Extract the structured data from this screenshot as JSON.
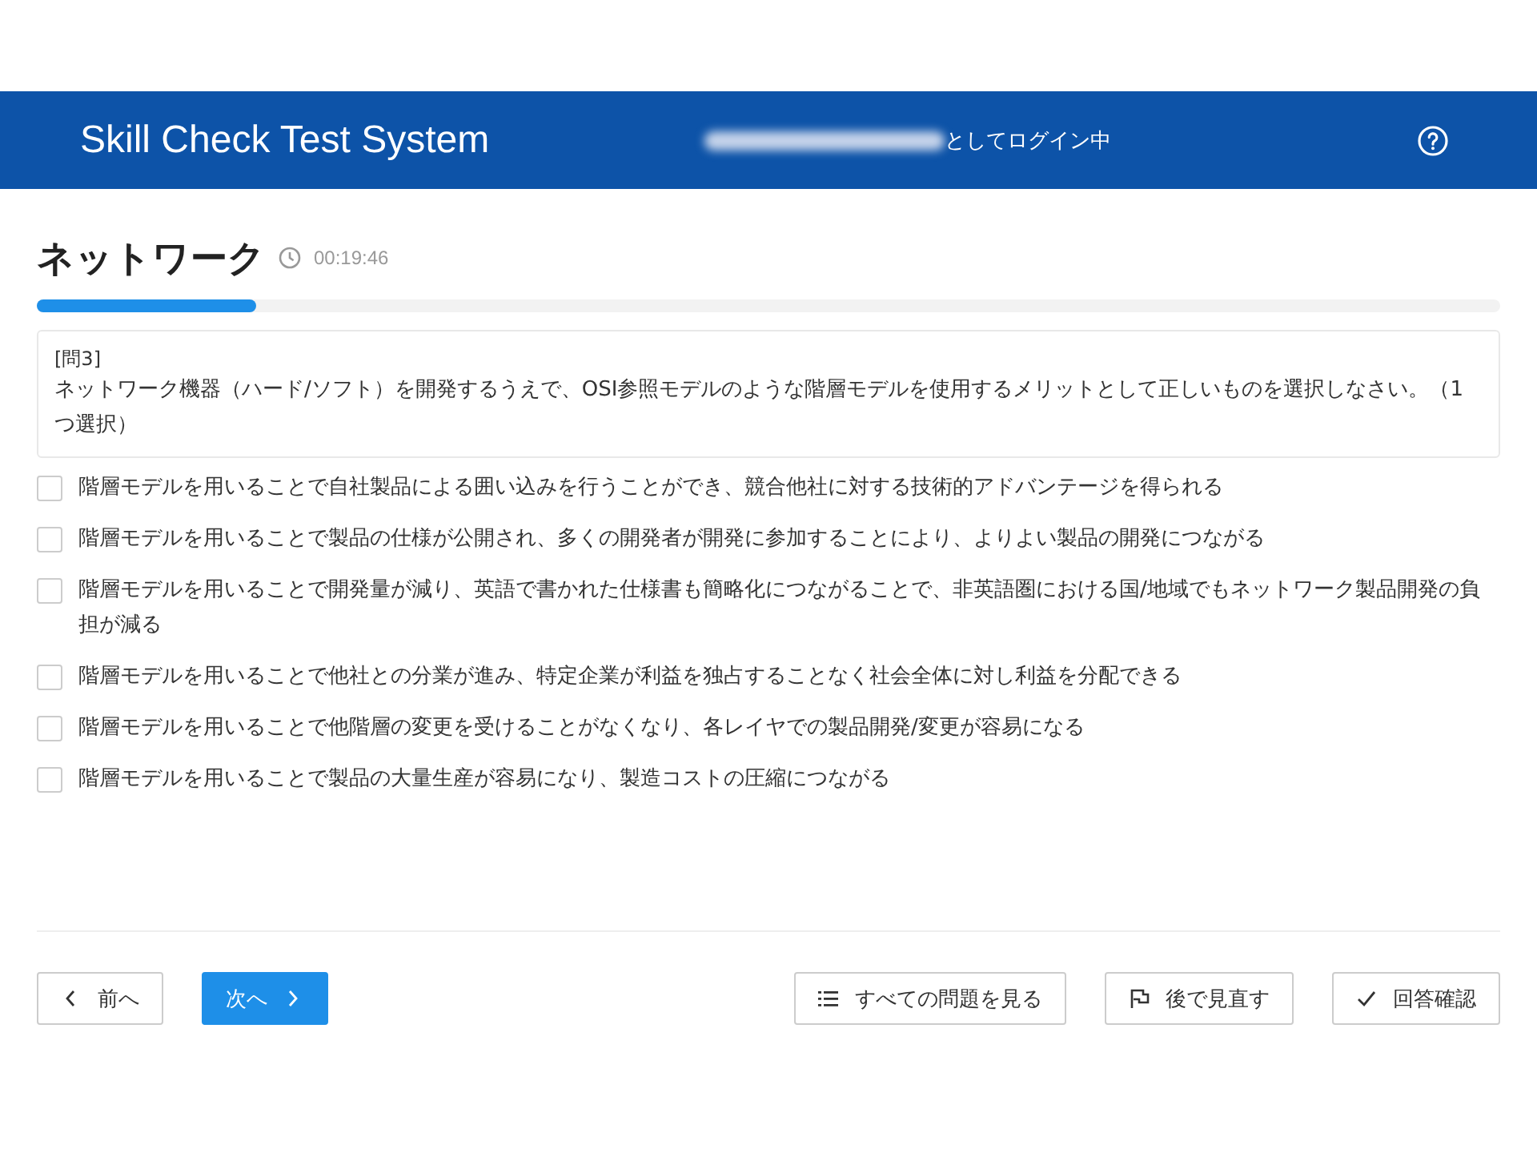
{
  "header": {
    "title": "Skill Check Test System",
    "login_suffix": "としてログイン中"
  },
  "quiz": {
    "title": "ネットワーク",
    "timer": "00:19:46",
    "progress": {
      "level": 0.15
    }
  },
  "question": {
    "number": "[問3]",
    "text": "ネットワーク機器（ハード/ソフト）を開発するうえで、OSI参照モデルのような階層モデルを使用するメリットとして正しいものを選択しなさい。（1つ選択）"
  },
  "options": [
    {
      "label": "階層モデルを用いることで自社製品による囲い込みを行うことができ、競合他社に対する技術的アドバンテージを得られる",
      "checked": false
    },
    {
      "label": "階層モデルを用いることで製品の仕様が公開され、多くの開発者が開発に参加することにより、よりよい製品の開発につながる",
      "checked": false
    },
    {
      "label": "階層モデルを用いることで開発量が減り、英語で書かれた仕様書も簡略化につながることで、非英語圏における国/地域でもネットワーク製品開発の負担が減る",
      "checked": false
    },
    {
      "label": "階層モデルを用いることで他社との分業が進み、特定企業が利益を独占することなく社会全体に対し利益を分配できる",
      "checked": false
    },
    {
      "label": "階層モデルを用いることで他階層の変更を受けることがなくなり、各レイヤでの製品開発/変更が容易になる",
      "checked": false
    },
    {
      "label": "階層モデルを用いることで製品の大量生産が容易になり、製造コストの圧縮につながる",
      "checked": false
    }
  ],
  "nav_left": [
    {
      "kind": "prev",
      "label": "前へ"
    },
    {
      "kind": "next",
      "label": "次へ"
    }
  ],
  "nav_right": [
    {
      "kind": "list",
      "label": "すべての問題を見る"
    },
    {
      "kind": "flag",
      "label": "後で見直す"
    },
    {
      "kind": "confirm",
      "label": "回答確認"
    }
  ]
}
